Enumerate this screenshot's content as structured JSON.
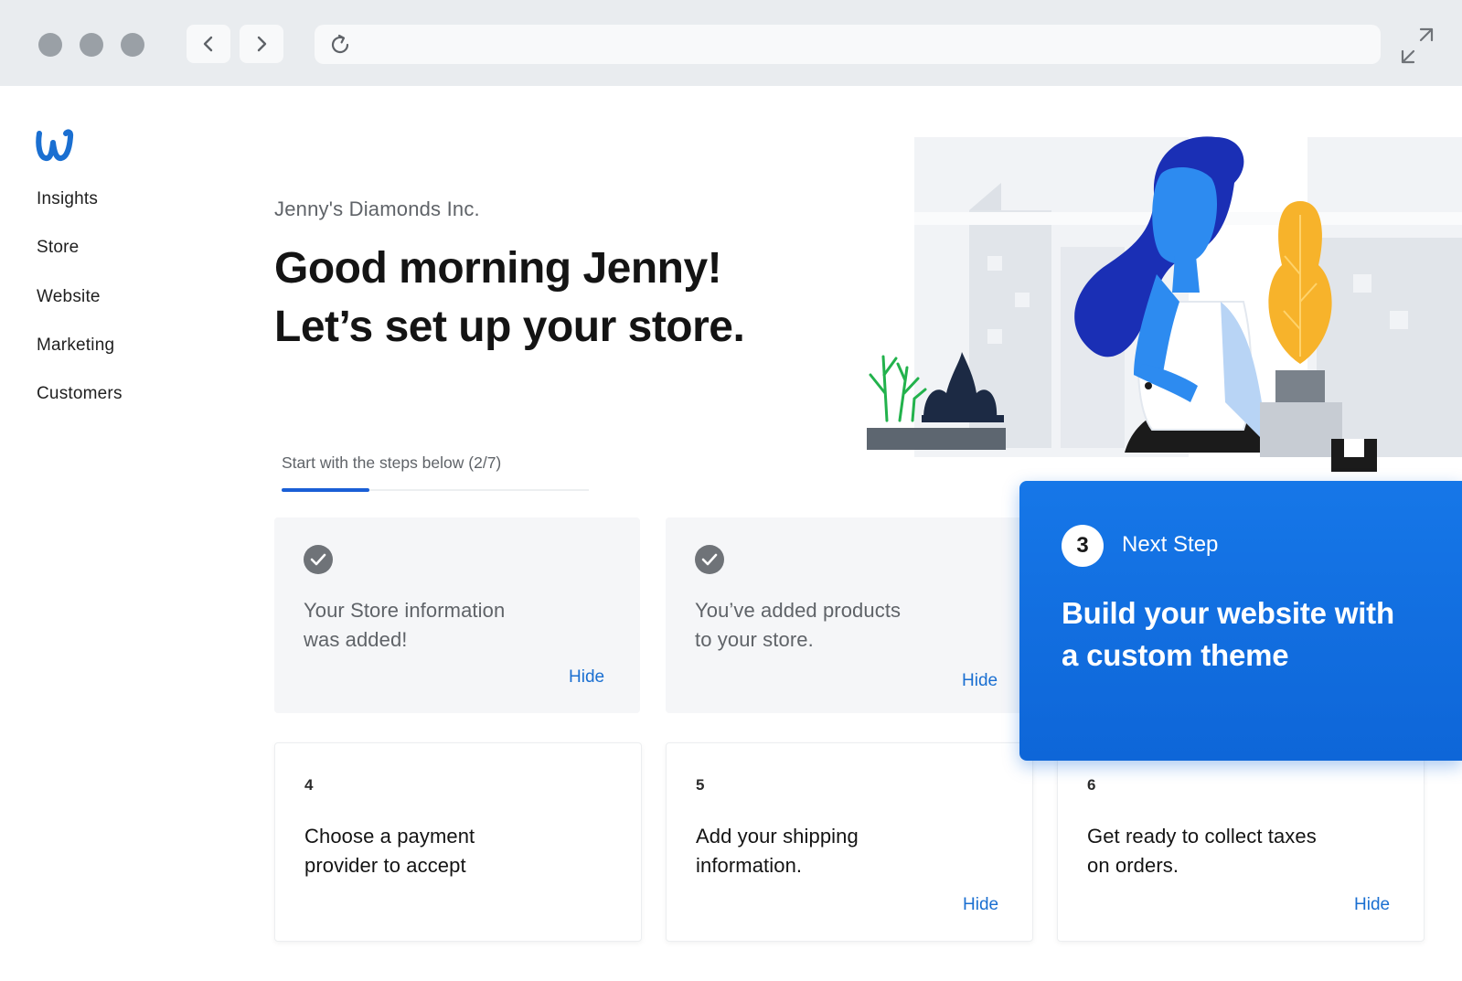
{
  "browser": {
    "window_controls": [
      "close",
      "minimize",
      "maximize"
    ],
    "back_icon": "chevron-left-icon",
    "forward_icon": "chevron-right-icon",
    "reload_icon": "reload-icon",
    "expand_icon": "expand-icon",
    "address_value": ""
  },
  "brand": {
    "logo_icon": "weebly-logo-icon",
    "color": "#1a6fd1"
  },
  "sidebar": {
    "items": [
      {
        "label": "Insights"
      },
      {
        "label": "Store"
      },
      {
        "label": "Website"
      },
      {
        "label": "Marketing"
      },
      {
        "label": "Customers"
      }
    ]
  },
  "header": {
    "company": "Jenny's Diamonds Inc.",
    "greeting_line1": "Good morning Jenny!",
    "greeting_line2": "Let’s set up your store."
  },
  "steps": {
    "label": "Start with the steps below (2/7)",
    "completed": 2,
    "total": 7
  },
  "completed_cards": [
    {
      "text_line1": "Your Store information",
      "text_line2": "was added!",
      "hide_label": "Hide",
      "icon": "checkmark-icon"
    },
    {
      "text_line1": "You’ve added products",
      "text_line2": "to your store.",
      "hide_label": "Hide",
      "icon": "checkmark-icon"
    }
  ],
  "next_step": {
    "number": "3",
    "label": "Next Step",
    "title_line1": "Build your website with",
    "title_line2": "a custom theme",
    "color": "#1677e8"
  },
  "todo_cards": [
    {
      "number": "4",
      "text_line1": "Choose a payment",
      "text_line2": "provider to accept",
      "hide_label": ""
    },
    {
      "number": "5",
      "text_line1": "Add your shipping",
      "text_line2": "information.",
      "hide_label": "Hide"
    },
    {
      "number": "6",
      "text_line1": "Get ready to collect taxes",
      "text_line2": "on orders.",
      "hide_label": "Hide"
    }
  ],
  "illustration": {
    "icon": "woman-thinking-illustration"
  }
}
